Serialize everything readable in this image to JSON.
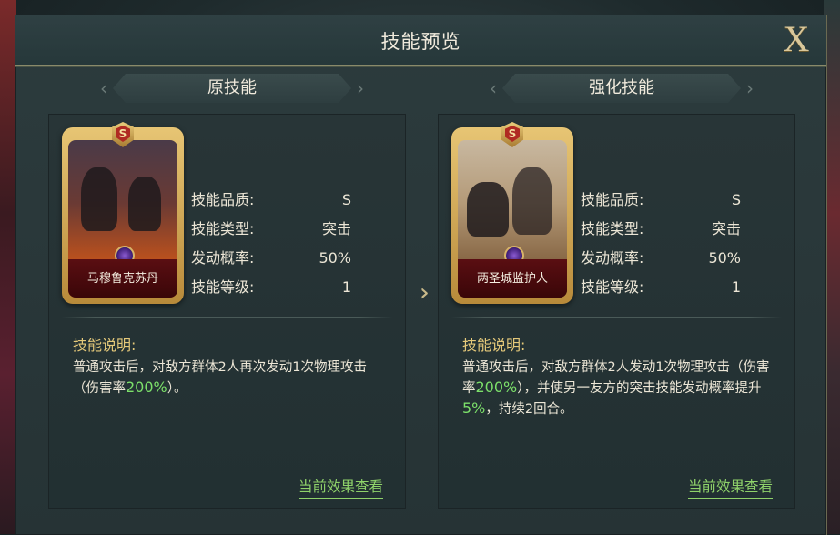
{
  "dialog": {
    "title": "技能预览",
    "close_label": "X"
  },
  "original": {
    "tag": "原技能",
    "card_name": "马穆鲁克苏丹",
    "card_grade": "S",
    "stats": [
      {
        "key": "技能品质:",
        "value": "S"
      },
      {
        "key": "技能类型:",
        "value": "突击"
      },
      {
        "key": "发动概率:",
        "value": "50%"
      },
      {
        "key": "技能等级:",
        "value": "1"
      }
    ],
    "desc_title": "技能说明:",
    "desc_parts": [
      "普通攻击后，对敌方群体2人再次发动1次物理攻击（伤害率",
      "200%",
      "）。"
    ],
    "link": "当前效果查看"
  },
  "enhanced": {
    "tag": "强化技能",
    "card_name": "两圣城监护人",
    "card_grade": "S",
    "stats": [
      {
        "key": "技能品质:",
        "value": "S"
      },
      {
        "key": "技能类型:",
        "value": "突击"
      },
      {
        "key": "发动概率:",
        "value": "50%"
      },
      {
        "key": "技能等级:",
        "value": "1"
      }
    ],
    "desc_title": "技能说明:",
    "desc_parts": [
      "普通攻击后，对敌方群体2人发动1次物理攻击（伤害率",
      "200%",
      "），并使另一友方的突击技能发动概率提升",
      "5%",
      "，持续2回合。"
    ],
    "link": "当前效果查看"
  },
  "icons": {
    "close": "close-icon",
    "arrow": "double-chevron-right-icon",
    "gem": "gem-icon",
    "grade": "grade-badge-icon"
  },
  "colors": {
    "highlight": "#7ce06a",
    "gold": "#e5c97a",
    "link": "#8fd26a"
  }
}
